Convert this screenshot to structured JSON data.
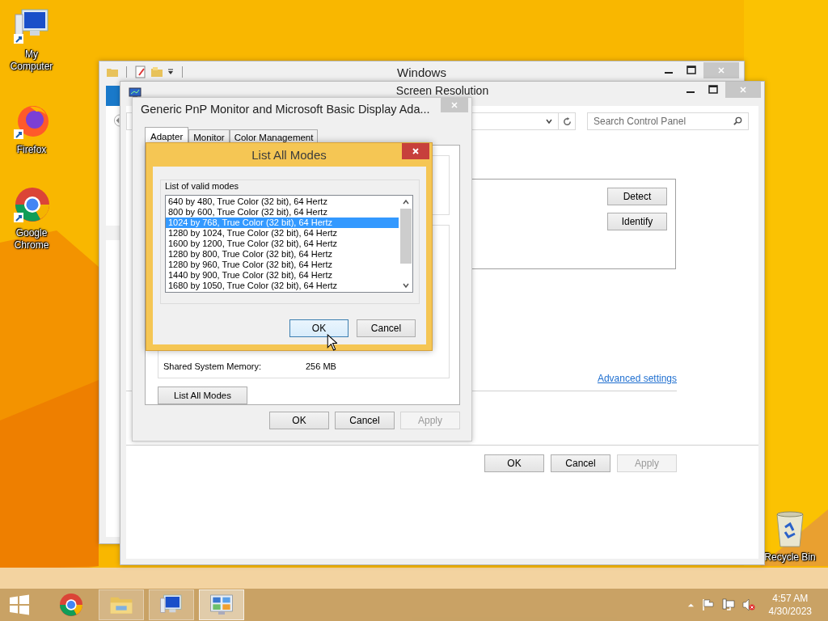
{
  "desktop_icons": [
    {
      "kind": "computer",
      "label": "My Computer"
    },
    {
      "kind": "firefox",
      "label": "Firefox"
    },
    {
      "kind": "chrome",
      "label": "Google Chrome"
    },
    {
      "kind": "recycle_bin",
      "label": "Recycle Bin"
    }
  ],
  "explorer_window": {
    "title": "Windows"
  },
  "resolution_window": {
    "title": "Screen Resolution",
    "search": {
      "placeholder": "Search Control Panel"
    },
    "display_buttons": [
      "Detect",
      "Identify"
    ],
    "advanced_link": "Advanced settings",
    "buttons": [
      {
        "label": "OK",
        "disabled": false
      },
      {
        "label": "Cancel",
        "disabled": false
      },
      {
        "label": "Apply",
        "disabled": true
      }
    ]
  },
  "adapter_dialog": {
    "title": "Generic PnP Monitor and Microsoft Basic Display Ada...",
    "tabs": [
      {
        "label": "Adapter",
        "selected": true
      },
      {
        "label": "Monitor",
        "selected": false
      },
      {
        "label": "Color Management",
        "selected": false
      }
    ],
    "memory_label": "Shared System Memory:",
    "memory_value": "256 MB",
    "list_button": "List All Modes",
    "buttons": [
      {
        "label": "OK",
        "disabled": false
      },
      {
        "label": "Cancel",
        "disabled": false
      },
      {
        "label": "Apply",
        "disabled": true
      }
    ]
  },
  "modes_dialog": {
    "title": "List All Modes",
    "group_label": "List of valid modes",
    "modes": [
      {
        "label": "640 by 480, True Color (32 bit), 64 Hertz",
        "selected": false
      },
      {
        "label": "800 by 600, True Color (32 bit), 64 Hertz",
        "selected": false
      },
      {
        "label": "1024 by 768, True Color (32 bit), 64 Hertz",
        "selected": true
      },
      {
        "label": "1280 by 1024, True Color (32 bit), 64 Hertz",
        "selected": false
      },
      {
        "label": "1600 by 1200, True Color (32 bit), 64 Hertz",
        "selected": false
      },
      {
        "label": "1280 by 800, True Color (32 bit), 64 Hertz",
        "selected": false
      },
      {
        "label": "1280 by 960, True Color (32 bit), 64 Hertz",
        "selected": false
      },
      {
        "label": "1440 by 900, True Color (32 bit), 64 Hertz",
        "selected": false
      },
      {
        "label": "1680 by 1050, True Color (32 bit), 64 Hertz",
        "selected": false
      }
    ],
    "buttons": [
      {
        "label": "OK",
        "focused": true
      },
      {
        "label": "Cancel",
        "focused": false
      }
    ]
  },
  "taskbar": {
    "apps": [
      {
        "kind": "chrome",
        "open": false,
        "selected": false
      },
      {
        "kind": "explorer",
        "open": true,
        "selected": false
      },
      {
        "kind": "computer",
        "open": true,
        "selected": false
      },
      {
        "kind": "control_panel",
        "open": true,
        "selected": true
      }
    ],
    "clock": {
      "time": "4:57 AM",
      "date": "4/30/2023"
    }
  }
}
